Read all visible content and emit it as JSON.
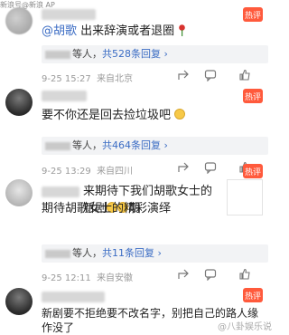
{
  "source_watermark": "新浪号@新浪 AP",
  "hot_badge": "热评",
  "watermark": "@八卦娱乐说",
  "comments": [
    {
      "text_mention": "@胡歌",
      "text": " 出来辞演或者退圈",
      "reply_count_text": "等人",
      "reply_link": "共528条回复",
      "time": "9-25 15:27",
      "location": "来自北京"
    },
    {
      "text": "要不你还是回去捡垃圾吧",
      "reply_count_text": "等人",
      "reply_link": "共464条回复",
      "time": "9-25 13:29",
      "location": "来自四川"
    },
    {
      "text_a": "来期待下我们胡歌女士的新剧",
      "text_b": "期待胡歌女士的精彩演绎",
      "reply_count_text": "等人",
      "reply_link": "共11条回复",
      "time": "9-25 12:11",
      "location": "来自安徽"
    },
    {
      "text": "新剧要不拒绝要不改名字，别把自己的路人缘作没了"
    }
  ],
  "icons": {
    "share": "share-icon",
    "comment": "comment-icon",
    "like": "like-icon",
    "hot": "hot-badge-icon"
  }
}
